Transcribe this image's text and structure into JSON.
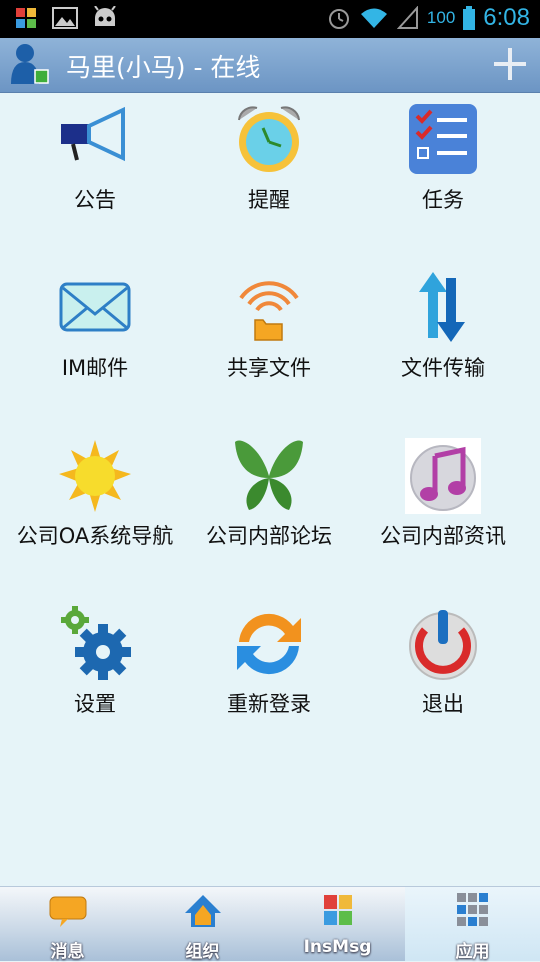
{
  "status_bar": {
    "battery_level": "100",
    "time": "6:08"
  },
  "title_bar": {
    "title": "马里(小马) - 在线",
    "add_icon": "plus-icon"
  },
  "apps": [
    {
      "label": "公告",
      "icon": "megaphone-icon"
    },
    {
      "label": "提醒",
      "icon": "alarm-clock-icon"
    },
    {
      "label": "任务",
      "icon": "task-list-icon"
    },
    {
      "label": "IM邮件",
      "icon": "mail-icon"
    },
    {
      "label": "共享文件",
      "icon": "shared-folder-icon"
    },
    {
      "label": "文件传输",
      "icon": "transfer-arrows-icon"
    },
    {
      "label": "公司OA系统导航",
      "icon": "sun-icon"
    },
    {
      "label": "公司内部论坛",
      "icon": "butterfly-icon"
    },
    {
      "label": "公司内部资讯",
      "icon": "music-note-icon"
    },
    {
      "label": "设置",
      "icon": "gears-icon"
    },
    {
      "label": "重新登录",
      "icon": "refresh-icon"
    },
    {
      "label": "退出",
      "icon": "power-icon"
    }
  ],
  "bottom_nav": {
    "tabs": [
      {
        "label": "消息",
        "icon": "chat-bubble-icon"
      },
      {
        "label": "组织",
        "icon": "home-icon"
      },
      {
        "label": "InsMsg",
        "icon": "puzzle-icon"
      },
      {
        "label": "应用",
        "icon": "apps-grid-icon"
      }
    ],
    "active": "应用"
  },
  "colors": {
    "accent": "#33b5e5",
    "title_bar": "#7ba3cf",
    "background": "#e6f4f8"
  }
}
